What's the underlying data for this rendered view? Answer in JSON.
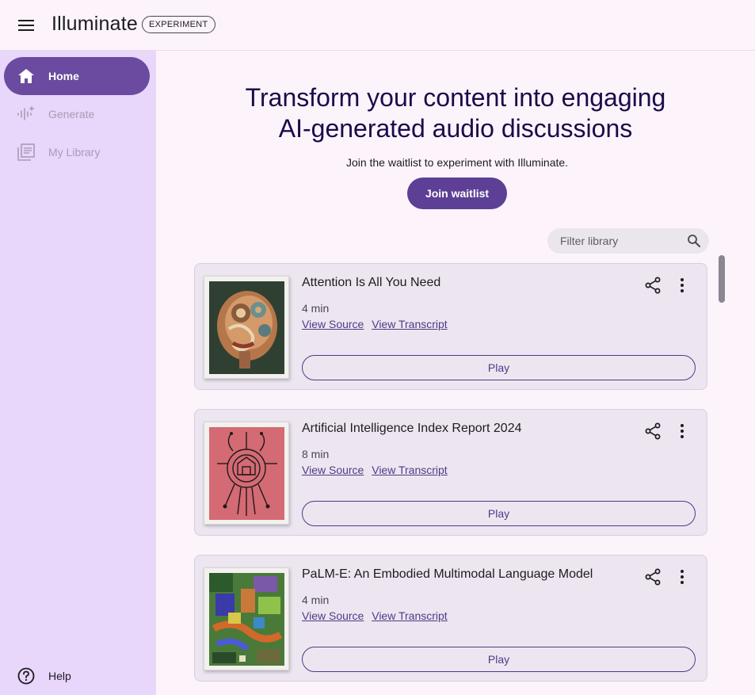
{
  "header": {
    "app_title": "Illuminate",
    "badge": "EXPERIMENT"
  },
  "sidebar": {
    "items": [
      {
        "label": "Home",
        "icon": "home-icon",
        "state": "active"
      },
      {
        "label": "Generate",
        "icon": "sparkle-waveform-icon",
        "state": "disabled"
      },
      {
        "label": "My Library",
        "icon": "library-icon",
        "state": "disabled"
      }
    ],
    "help_label": "Help"
  },
  "hero": {
    "title_line1": "Transform your content into engaging",
    "title_line2": "AI-generated audio discussions",
    "subtitle": "Join the waitlist to experiment with Illuminate.",
    "cta_label": "Join waitlist"
  },
  "filter": {
    "placeholder": "Filter library"
  },
  "cards": [
    {
      "title": "Attention Is All You Need",
      "duration": "4 min",
      "view_source": "View Source",
      "view_transcript": "View Transcript",
      "play_label": "Play"
    },
    {
      "title": "Artificial Intelligence Index Report 2024",
      "duration": "8 min",
      "view_source": "View Source",
      "view_transcript": "View Transcript",
      "play_label": "Play"
    },
    {
      "title": "PaLM-E: An Embodied Multimodal Language Model",
      "duration": "4 min",
      "view_source": "View Source",
      "view_transcript": "View Transcript",
      "play_label": "Play"
    }
  ],
  "colors": {
    "accent": "#5e3f96",
    "sidebar_bg": "#e8d6fb",
    "page_bg": "#fdf4fb",
    "card_bg": "#ede6f1"
  }
}
